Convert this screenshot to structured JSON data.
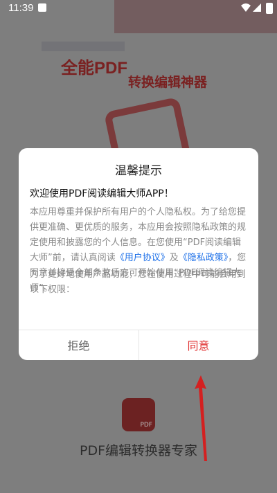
{
  "status_bar": {
    "time": "11:39"
  },
  "splash": {
    "title_line1": "全能PDF",
    "title_line2": "转换编辑神器",
    "app_name": "PDF编辑转换器专家",
    "logo_label": "PDF"
  },
  "dialog": {
    "title": "温馨提示",
    "welcome": "欢迎使用PDF阅读编辑大师APP！",
    "body_part1": "本应用尊重并保护所有用户的个人隐私权。为了给您提供更准确、更优质的服务，本应用会按照隐私政策的规定使用和披露您的个人信息。在您使用“PDF阅读编辑大师”前，请认真阅读",
    "user_agreement_link": "《用户协议》",
    "and_text": "及",
    "privacy_link": "《隐私政策》",
    "body_part2": "，您同意并接受全部条款后方可开始使用“PDF阅读编辑大师”。",
    "body_para2": "为了更好地使用产品功能，您在使用过程中可能会用到以下权限：",
    "reject_label": "拒绝",
    "agree_label": "同意"
  },
  "colors": {
    "agree": "#e03030",
    "link": "#1a6ee8",
    "arrow": "#d42020"
  }
}
